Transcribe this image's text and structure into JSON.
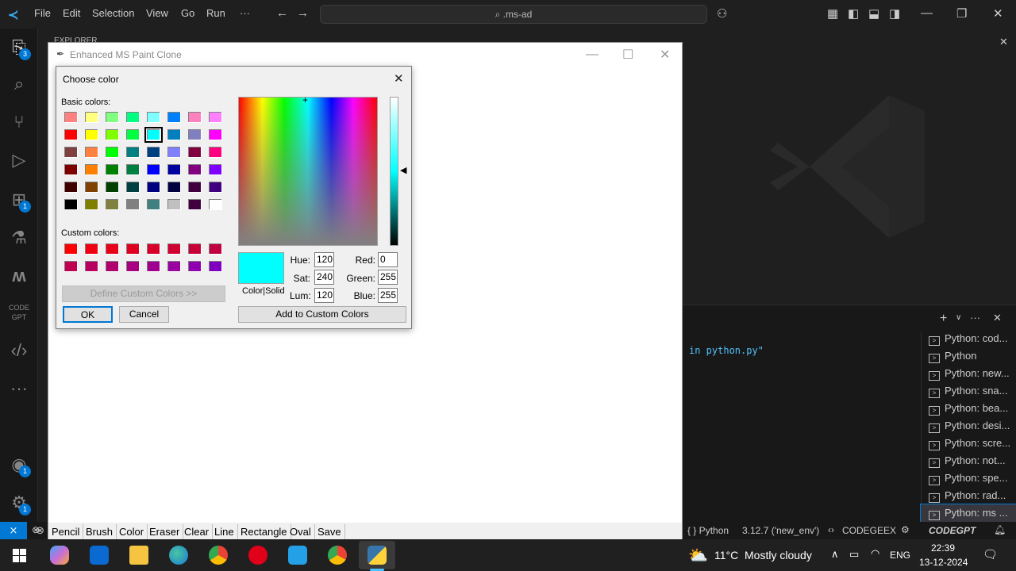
{
  "vscode": {
    "menus": [
      "File",
      "Edit",
      "Selection",
      "View",
      "Go",
      "Run",
      "···"
    ],
    "command_center": "⌕ .ms-ad",
    "explorer_label": "EXPLORER",
    "badges": {
      "explorer": "3",
      "extensions": "1",
      "accounts": "1",
      "settings": "1"
    },
    "panel_output_text": "in python.py\"",
    "terminals": [
      "Python: cod...",
      "Python",
      "Python: new...",
      "Python: sna...",
      "Python: bea...",
      "Python: desi...",
      "Python: scre...",
      "Python: not...",
      "Python: spe...",
      "Python: rad...",
      "Python: ms ..."
    ],
    "statusbar": {
      "left_icon": "⊗",
      "language": "{ } Python",
      "interpreter": "3.12.7 ('new_env')",
      "codegeex": "CODEGEEX",
      "codegpt": "CODEGPT"
    }
  },
  "tk_window": {
    "title": "Enhanced MS Paint Clone",
    "toolbar": [
      "Pencil",
      "Brush",
      "Color",
      "Eraser",
      "Clear",
      "Line",
      "Rectangle",
      "Oval",
      "Save"
    ]
  },
  "color_dialog": {
    "title": "Choose color",
    "basic_colors_label": "Basic colors:",
    "custom_colors_label": "Custom colors:",
    "define_custom_button": "Define Custom Colors >>",
    "ok_button": "OK",
    "cancel_button": "Cancel",
    "add_custom_button": "Add to Custom Colors",
    "color_solid_label": "Color|Solid",
    "selected_color": "#00ffff",
    "fields": {
      "hue_label": "Hue:",
      "hue": "120",
      "sat_label": "Sat:",
      "sat": "240",
      "lum_label": "Lum:",
      "lum": "120",
      "red_label": "Red:",
      "red": "0",
      "green_label": "Green:",
      "green": "255",
      "blue_label": "Blue:",
      "blue": "255"
    },
    "basic_colors": [
      [
        "#ff8080",
        "#ffff80",
        "#80ff80",
        "#00ff80",
        "#80ffff",
        "#0080ff",
        "#ff80c0",
        "#ff80ff"
      ],
      [
        "#ff0000",
        "#ffff00",
        "#80ff00",
        "#00ff40",
        "#00ffff",
        "#0080c0",
        "#8080c0",
        "#ff00ff"
      ],
      [
        "#804040",
        "#ff8040",
        "#00ff00",
        "#008080",
        "#004080",
        "#8080ff",
        "#800040",
        "#ff0080"
      ],
      [
        "#800000",
        "#ff8000",
        "#008000",
        "#008040",
        "#0000ff",
        "#0000a0",
        "#800080",
        "#8000ff"
      ],
      [
        "#400000",
        "#804000",
        "#004000",
        "#004040",
        "#000080",
        "#000040",
        "#400040",
        "#400080"
      ],
      [
        "#000000",
        "#808000",
        "#808040",
        "#808080",
        "#408080",
        "#c0c0c0",
        "#400040",
        "#ffffff"
      ]
    ],
    "custom_colors": [
      [
        "#ff0000",
        "#f00010",
        "#e80018",
        "#e00020",
        "#d80028",
        "#d00030",
        "#c80038",
        "#c00040"
      ],
      [
        "#c00050",
        "#b80060",
        "#b00070",
        "#a80080",
        "#a00090",
        "#9800a0",
        "#9000b0",
        "#8000c0"
      ]
    ]
  },
  "taskbar": {
    "weather": "11°C  Mostly cloudy",
    "lang": "ENG",
    "time": "22:39",
    "date": "13-12-2024"
  }
}
